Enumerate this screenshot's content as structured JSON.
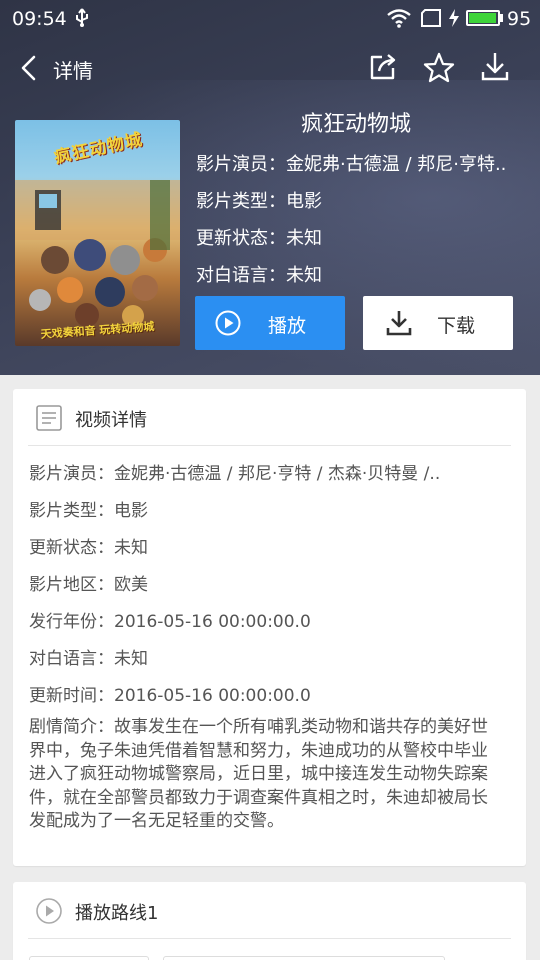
{
  "status_bar": {
    "time": "09:54",
    "battery_percent": "95",
    "battery_level": 0.95
  },
  "app_bar": {
    "title": "详情"
  },
  "movie": {
    "title": "疯狂动物城",
    "poster_logo": "疯狂动物城",
    "poster_tagline_top": "",
    "poster_tagline_bottom": "天戏奏和音 玩转动物城",
    "header_info": [
      "影片演员：金妮弗·古德温 / 邦尼·亨特..",
      "影片类型：电影",
      "更新状态：未知",
      "对白语言：未知"
    ]
  },
  "actions": {
    "play_label": "播放",
    "download_label": "下载"
  },
  "details_card": {
    "title": "视频详情",
    "lines": [
      "影片演员：金妮弗·古德温 / 邦尼·亨特 / 杰森·贝特曼 /..",
      "影片类型：电影",
      "更新状态：未知",
      "影片地区：欧美",
      "发行年份：2016-05-16 00:00:00.0",
      "对白语言：未知",
      "更新时间：2016-05-16 00:00:00.0"
    ],
    "synopsis": "剧情简介：故事发生在一个所有哺乳类动物和谐共存的美好世界中，兔子朱迪凭借着智慧和努力，朱迪成功的从警校中毕业进入了疯狂动物城警察局，近日里，城中接连发生动物失踪案件，就在全部警员都致力于调查案件真相之时，朱迪却被局长发配成为了一名无足轻重的交警。"
  },
  "route_card": {
    "title": "播放路线1"
  },
  "colors": {
    "primary": "#2b8ff2",
    "header_bg": "#353a4f",
    "page_bg": "#ececec",
    "battery": "#3ed43a"
  },
  "icons": {
    "back": "chevron-left-icon",
    "share": "share-icon",
    "favorite": "star-icon",
    "download": "download-icon",
    "play": "play-circle-icon",
    "details": "document-icon",
    "route": "play-circle-icon"
  }
}
